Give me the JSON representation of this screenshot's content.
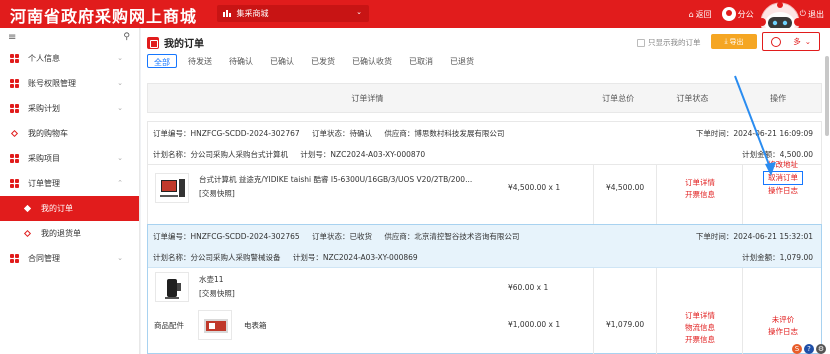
{
  "header": {
    "brand": "河南省政府采购网上商城",
    "mall_select": "集采商城",
    "back_label": "返回",
    "user_label": "分公",
    "logout_label": "退出"
  },
  "sidebar": {
    "items": [
      {
        "label": "个人信息"
      },
      {
        "label": "账号权限管理"
      },
      {
        "label": "采购计划"
      },
      {
        "label": "我的购物车"
      },
      {
        "label": "采购项目"
      },
      {
        "label": "订单管理"
      },
      {
        "label": "我的订单"
      },
      {
        "label": "我的退货单"
      },
      {
        "label": "合同管理"
      }
    ]
  },
  "main": {
    "title": "我的订单",
    "only_mine": "只显示我的订单",
    "export_label": "导出",
    "more_label": "多",
    "tabs": [
      {
        "label": "全部"
      },
      {
        "label": "待发送"
      },
      {
        "label": "待确认"
      },
      {
        "label": "已确认"
      },
      {
        "label": "已发货"
      },
      {
        "label": "已确认收货"
      },
      {
        "label": "已取消"
      },
      {
        "label": "已退货"
      }
    ],
    "columns": {
      "detail": "订单详情",
      "total": "订单总价",
      "status": "订单状态",
      "ops": "操作"
    }
  },
  "orders": [
    {
      "order_no": "订单编号：HNZFCG-SCDD-2024-302767",
      "status": "订单状态：待确认",
      "supplier": "供应商：博思数村科技发展有限公司",
      "time": "下单时间：2024-06-21 16:09:09",
      "plan_name": "计划名称：分公司采购人采购台式计算机",
      "plan_no": "计划号：NZC2024-A03-XY-000870",
      "plan_amount": "计划金额：4,500.00",
      "product_name": "台式计算机 益途克/YIDIKE taishi 酷睿 I5-6300U/16GB/3/UOS V20/2TB/200...",
      "product_tag": "[交易快照]",
      "qty": "¥4,500.00 x 1",
      "total": "¥4,500.00",
      "status_links": [
        "订单详情",
        "开票信息"
      ],
      "op_links": [
        "修改地址",
        "取消订单",
        "操作日志"
      ]
    },
    {
      "order_no": "订单编号：HNZFCG-SCDD-2024-302765",
      "status": "订单状态：已收货",
      "supplier": "供应商：北京清控智谷技术咨询有限公司",
      "time": "下单时间：2024-06-21 15:32:01",
      "plan_name": "计划名称：分公司采购人采购警械设备",
      "plan_no": "计划号：NZC2024-A03-XY-000869",
      "plan_amount": "计划金额：1,079.00",
      "product1_name": "水壶11",
      "product1_tag": "[交易快照]",
      "product1_qty": "¥60.00 x 1",
      "accessory_label": "商品配件",
      "product2_name": "电表箱",
      "product2_qty": "¥1,000.00 x 1",
      "total": "¥1,079.00",
      "status_links": [
        "订单详情",
        "物流信息",
        "开票信息"
      ],
      "op_links": [
        "未评价",
        "操作日志"
      ]
    }
  ]
}
